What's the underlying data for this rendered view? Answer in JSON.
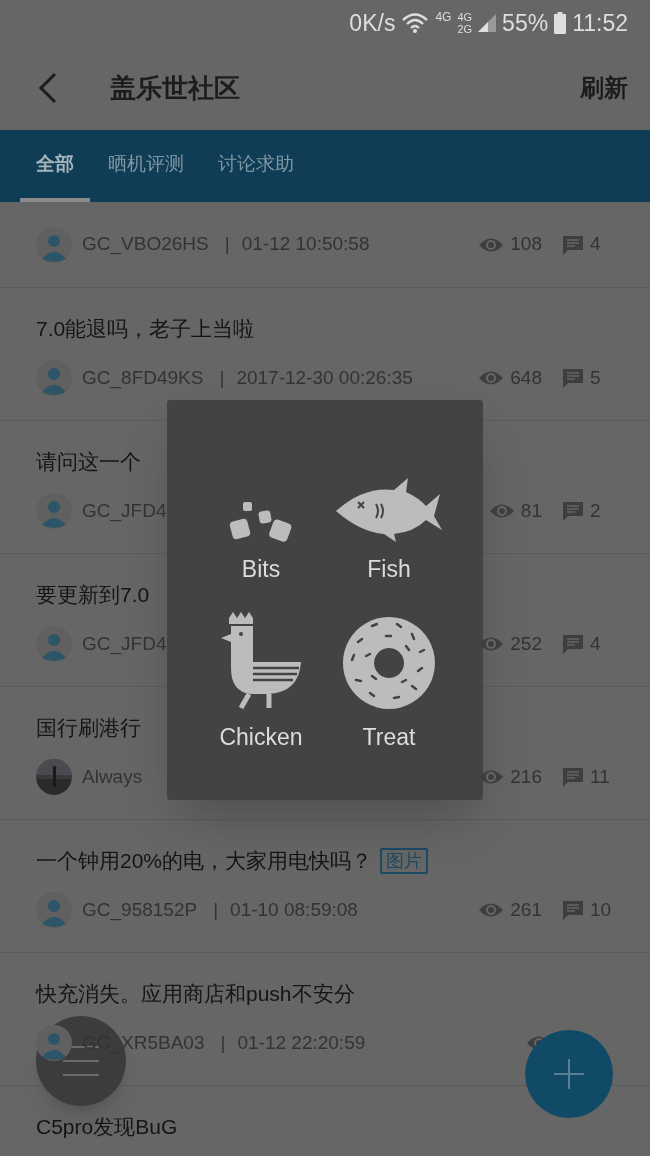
{
  "status_bar": {
    "speed": "0K/s",
    "net_a": "4G",
    "net_b_top": "4G",
    "net_b_bottom": "2G",
    "battery": "55%",
    "time": "11:52"
  },
  "header": {
    "title": "盖乐世社区",
    "action": "刷新"
  },
  "tabs": [
    {
      "label": "全部",
      "selected": true
    },
    {
      "label": "晒机评测",
      "selected": false
    },
    {
      "label": "讨论求助",
      "selected": false
    }
  ],
  "posts": [
    {
      "author": "GC_VBO26HS",
      "separator": "|",
      "time": "01-12 10:50:58",
      "views": "108",
      "comments": "4",
      "kind": "default"
    },
    {
      "title": "7.0能退吗，老子上当啦",
      "author": "GC_8FD49KS",
      "separator": "|",
      "time": "2017-12-30 00:26:35",
      "views": "648",
      "comments": "5",
      "kind": "default"
    },
    {
      "title": "请问这一个",
      "author": "GC_JFD4",
      "views": "81",
      "comments": "2",
      "kind": "default"
    },
    {
      "title": "要更新到7.0",
      "author": "GC_JFD4",
      "views": "252",
      "comments": "4",
      "kind": "default"
    },
    {
      "title": "国行刷港行",
      "author": "Always",
      "views": "216",
      "comments": "11",
      "kind": "picture"
    },
    {
      "title": "一个钟用20%的电，大家用电快吗？",
      "badge": "图片",
      "author": "GC_958152P",
      "separator": "|",
      "time": "01-10 08:59:08",
      "views": "261",
      "comments": "10",
      "kind": "default"
    },
    {
      "title": "快充消失。应用商店和push不安分",
      "author": "GC_XR5BA03",
      "separator": "|",
      "time": "01-12 22:20:59",
      "kind": "default"
    },
    {
      "title": "C5pro发现BuG"
    }
  ],
  "popup": {
    "items": [
      {
        "kind": "bits",
        "label": "Bits"
      },
      {
        "kind": "fish",
        "label": "Fish"
      },
      {
        "kind": "chicken",
        "label": "Chicken"
      },
      {
        "kind": "treat",
        "label": "Treat"
      }
    ]
  }
}
